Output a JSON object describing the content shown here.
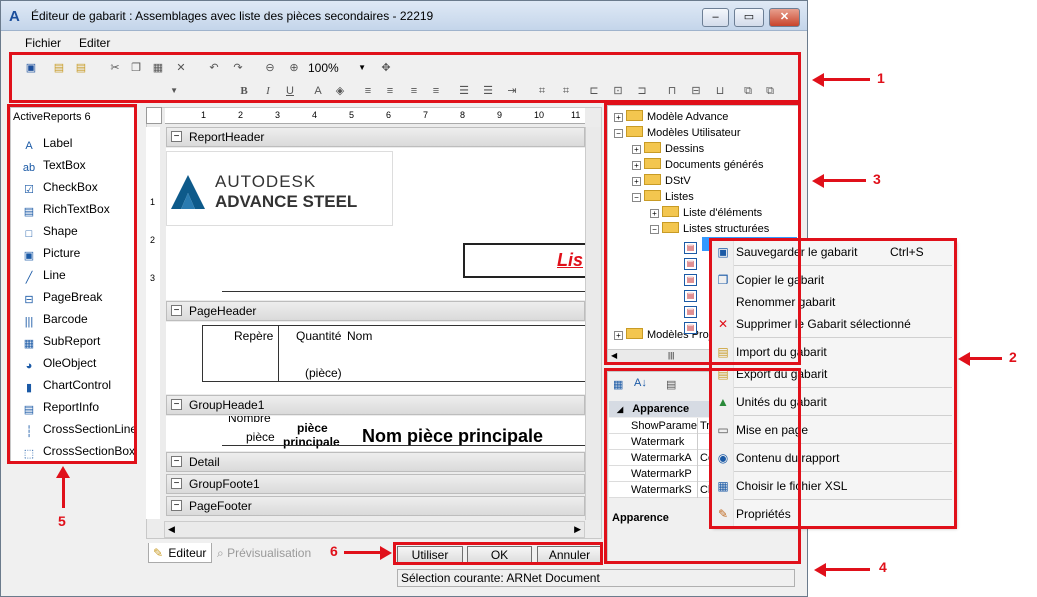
{
  "window": {
    "title": "Éditeur de gabarit : Assemblages avec liste des pièces secondaires - 22219"
  },
  "menu": [
    "Fichier",
    "Editer"
  ],
  "toolbar": {
    "zoom": "100%"
  },
  "toolbox": {
    "title": "ActiveReports 6",
    "items": [
      {
        "label": "Label",
        "icon": "label-icon"
      },
      {
        "label": "TextBox",
        "icon": "textbox-icon"
      },
      {
        "label": "CheckBox",
        "icon": "checkbox-icon"
      },
      {
        "label": "RichTextBox",
        "icon": "richtextbox-icon"
      },
      {
        "label": "Shape",
        "icon": "shape-icon"
      },
      {
        "label": "Picture",
        "icon": "picture-icon"
      },
      {
        "label": "Line",
        "icon": "line-icon"
      },
      {
        "label": "PageBreak",
        "icon": "pagebreak-icon"
      },
      {
        "label": "Barcode",
        "icon": "barcode-icon"
      },
      {
        "label": "SubReport",
        "icon": "subreport-icon"
      },
      {
        "label": "OleObject",
        "icon": "oleobject-icon"
      },
      {
        "label": "ChartControl",
        "icon": "chart-icon"
      },
      {
        "label": "ReportInfo",
        "icon": "reportinfo-icon"
      },
      {
        "label": "CrossSectionLine",
        "icon": "crosssectionline-icon"
      },
      {
        "label": "CrossSectionBox",
        "icon": "crosssectionbox-icon"
      }
    ]
  },
  "ruler": [
    "1",
    "2",
    "3",
    "4",
    "5",
    "6",
    "7",
    "8",
    "9",
    "10",
    "11"
  ],
  "vruler": [
    "1",
    "2",
    "3"
  ],
  "designer": {
    "bands": {
      "report_header": "ReportHeader",
      "page_header": "PageHeader",
      "group_header": "GroupHeade1",
      "detail": "Detail",
      "group_footer": "GroupFoote1",
      "page_footer": "PageFooter"
    },
    "logo_line1": "AUTODESK",
    "logo_line2": "ADVANCE STEEL",
    "header_red_text": "Lis",
    "col_repere": "Repère",
    "col_quantite": "Quantité",
    "col_nom": "Nom",
    "col_piece": "(pièce)",
    "gh_nombre": "Nombre",
    "gh_piece": "pièce",
    "gh_piece_bold": "pièce",
    "gh_principale": "principale",
    "gh_nom": "Nom pièce principale"
  },
  "tabs": {
    "editor": "Editeur",
    "preview": "Prévisualisation"
  },
  "buttons": {
    "use": "Utiliser",
    "ok": "OK",
    "cancel": "Annuler"
  },
  "status": "Sélection courante: ARNet Document",
  "tree": [
    {
      "label": "Modèle Advance"
    },
    {
      "label": "Modèles Utilisateur"
    },
    {
      "label": "Dessins"
    },
    {
      "label": "Documents générés"
    },
    {
      "label": "DStV"
    },
    {
      "label": "Listes"
    },
    {
      "label": "Liste d'éléments"
    },
    {
      "label": "Listes structurées"
    },
    {
      "label": "Modèles Proj"
    }
  ],
  "props": {
    "category": "Apparence",
    "rows": [
      {
        "name": "ShowParame",
        "value": "Tr"
      },
      {
        "name": "Watermark",
        "value": ""
      },
      {
        "name": "WatermarkA",
        "value": "Ce"
      },
      {
        "name": "WatermarkP",
        "value": ""
      },
      {
        "name": "WatermarkS",
        "value": "Cli"
      }
    ],
    "desc": "Apparence"
  },
  "context_menu": [
    {
      "label": "Sauvegarder le gabarit",
      "shortcut": "Ctrl+S",
      "icon": "save-icon"
    },
    {
      "label": "Copier le gabarit",
      "shortcut": "",
      "icon": "copy-icon"
    },
    {
      "label": "Renommer gabarit",
      "shortcut": "",
      "icon": ""
    },
    {
      "label": "Supprimer le Gabarit sélectionné",
      "shortcut": "",
      "icon": "delete-icon"
    },
    {
      "label": "Import du gabarit",
      "shortcut": "",
      "icon": "import-icon"
    },
    {
      "label": "Export du gabarit",
      "shortcut": "",
      "icon": "export-icon"
    },
    {
      "label": "Unités du gabarit",
      "shortcut": "",
      "icon": "units-icon"
    },
    {
      "label": "Mise en page",
      "shortcut": "",
      "icon": "page-setup-icon"
    },
    {
      "label": "Contenu du rapport",
      "shortcut": "",
      "icon": "report-content-icon"
    },
    {
      "label": "Choisir le fichier XSL",
      "shortcut": "",
      "icon": "xsl-file-icon"
    },
    {
      "label": "Propriétés",
      "shortcut": "",
      "icon": "properties-icon"
    }
  ],
  "callouts": [
    "1",
    "2",
    "3",
    "4",
    "5",
    "6"
  ]
}
